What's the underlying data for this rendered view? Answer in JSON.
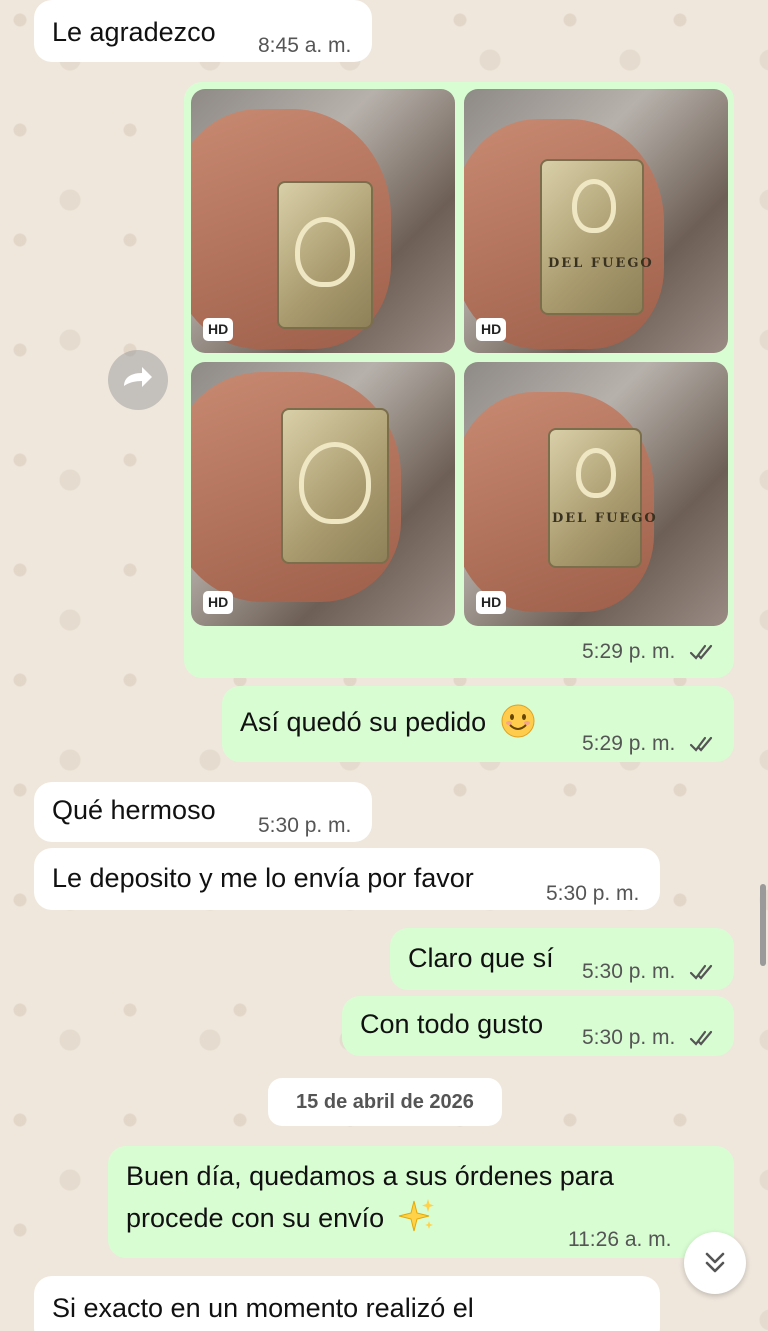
{
  "messages": {
    "m1": {
      "text": "Le agradezco",
      "time": "8:45 a. m."
    },
    "gallery": {
      "time": "5:29 p. m.",
      "hd_label": "HD",
      "brand_text": "DEL FUEGO"
    },
    "m2": {
      "text": "Así quedó su pedido",
      "time": "5:29 p. m."
    },
    "m3": {
      "text": "Qué hermoso",
      "time": "5:30 p. m."
    },
    "m4": {
      "text": "Le deposito y me lo envía por favor",
      "time": "5:30 p. m."
    },
    "m5": {
      "text": "Claro que sí",
      "time": "5:30 p. m."
    },
    "m6": {
      "text": "Con todo gusto",
      "time": "5:30 p. m."
    },
    "date_separator": "15 de abril de 2026",
    "m7": {
      "line1": "Buen día, quedamos a sus órdenes para",
      "line2": "procede con su envío",
      "time": "11:26 a. m."
    },
    "m8": {
      "text": "Si exacto en un momento realizó el"
    }
  },
  "colors": {
    "incoming": "#ffffff",
    "outgoing": "#d9fdd3",
    "read_ticks": "#53bdeb",
    "background": "#efe7dc"
  },
  "icons": {
    "forward": "forward-icon",
    "read_receipt": "double-check-icon",
    "scroll_down": "chevron-down-double-icon"
  }
}
